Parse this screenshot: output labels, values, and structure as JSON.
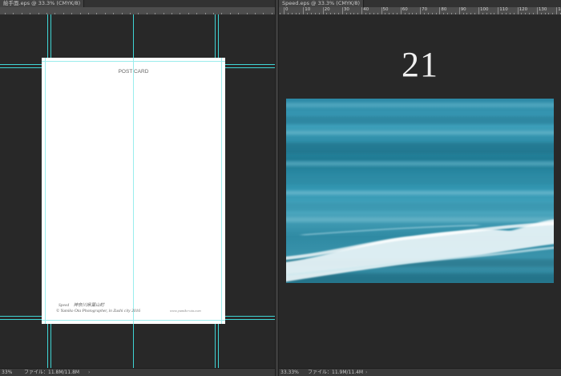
{
  "left_document": {
    "tab_title": "絵手面.eps @ 33.3% (CMYK/8)",
    "ruler_labels": [],
    "status": {
      "zoom": "33%",
      "file_info": "ファイル：11.8M/11.8M"
    },
    "postcard": {
      "title": "POST CARD",
      "caption": "Speed　神奈川県葉山町",
      "credit": "© Yumiko Ota Photographer, in Zushi city 2016",
      "url": "www.yumiko-ota.com"
    }
  },
  "right_document": {
    "tab_title": "Speed.eps @ 33.3% (CMYK/8)",
    "ruler_labels": [
      "0",
      "10",
      "20",
      "30",
      "40",
      "50",
      "60",
      "70",
      "80",
      "90",
      "100",
      "110",
      "120",
      "130",
      "140"
    ],
    "page_number": "21",
    "status": {
      "zoom": "33.33%",
      "file_info": "ファイル：11.9M/11.4M"
    },
    "photo": {
      "subject": "motion-blurred ocean wave"
    }
  },
  "colors": {
    "workspace": "#282828",
    "guide": "#3fd4d4",
    "ruler": "#4d4d4d",
    "status_bar": "#3a3a3a"
  },
  "icons": {
    "status_arrow": "chevron-right-icon"
  }
}
